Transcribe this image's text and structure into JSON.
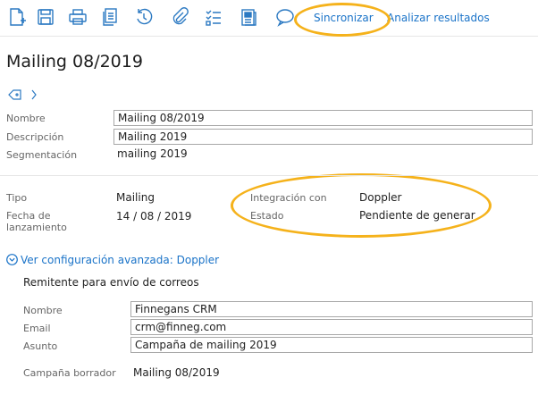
{
  "toolbar": {
    "icons": [
      "new-document-icon",
      "save-icon",
      "print-icon",
      "copy-icon",
      "history-icon",
      "attach-icon",
      "checklist-icon",
      "report-icon",
      "comment-icon"
    ],
    "sync_label": "Sincronizar",
    "analyze_label": "Analizar resultados"
  },
  "page": {
    "title": "Mailing 08/2019"
  },
  "form": {
    "nombre_label": "Nombre",
    "nombre_value": "Mailing 08/2019",
    "descripcion_label": "Descripción",
    "descripcion_value": "Mailing 2019",
    "segmentacion_label": "Segmentación",
    "segmentacion_value": "mailing 2019"
  },
  "details": {
    "tipo_label": "Tipo",
    "tipo_value": "Mailing",
    "fecha_label_1": "Fecha de",
    "fecha_label_2": "lanzamiento",
    "fecha_value": "14 / 08 / 2019",
    "integracion_label": "Integración con",
    "integracion_value": "Doppler",
    "estado_label": "Estado",
    "estado_value": "Pendiente de generar"
  },
  "advanced": {
    "toggle_label": "Ver configuración avanzada: Doppler",
    "section_title": "Remitente para envío de correos",
    "nombre_label": "Nombre",
    "nombre_value": "Finnegans CRM",
    "email_label": "Email",
    "email_value": "crm@finneg.com",
    "asunto_label": "Asunto",
    "asunto_value": "Campaña de mailing 2019",
    "borrador_label": "Campaña borrador",
    "borrador_value": "Mailing 08/2019"
  },
  "colors": {
    "link": "#1a73c8",
    "icon": "#2b79c2",
    "highlight": "#f5b21b"
  }
}
